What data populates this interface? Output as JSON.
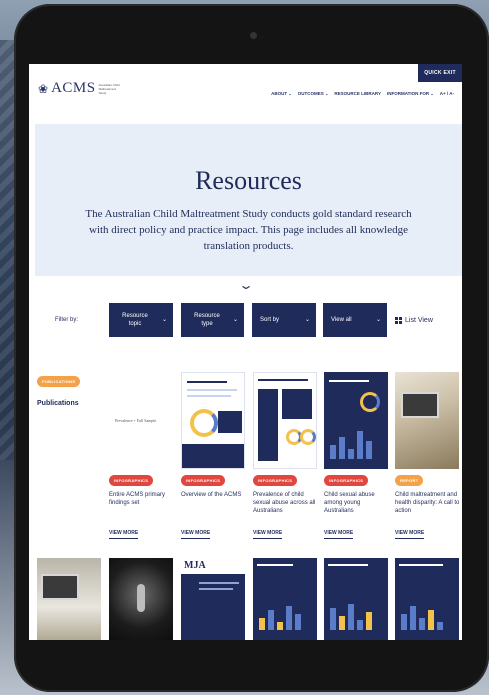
{
  "header": {
    "quick_exit": "QUICK EXIT",
    "logo_text": "ACMS",
    "logo_sub": "Australian Child Maltreatment Study",
    "menu": [
      "ABOUT",
      "OUTCOMES",
      "RESOURCE LIBRARY",
      "INFORMATION FOR",
      "A+ / A-"
    ]
  },
  "hero": {
    "title": "Resources",
    "text": "The Australian Child Maltreatment Study conducts gold standard research with direct policy and practice impact. This page includes all knowledge translation products."
  },
  "filters": {
    "label": "Filter by:",
    "buttons": [
      "Resource topic",
      "Resource type",
      "Sort by",
      "View all"
    ],
    "list_view": "List View"
  },
  "section": {
    "badge": "PUBLICATIONS",
    "label": "Publications"
  },
  "cards": [
    {
      "badge": "INFOGRAPHICS",
      "title": "Entire ACMS primary findings set",
      "thumb_text": "Prevalence + Full Sample",
      "view": "VIEW MORE"
    },
    {
      "badge": "INFOGRAPHICS",
      "title": "Overview of the ACMS",
      "view": "VIEW MORE"
    },
    {
      "badge": "INFOGRAPHICS",
      "title": "Prevalence of child sexual abuse across all Australians",
      "view": "VIEW MORE"
    },
    {
      "badge": "INFOGRAPHICS",
      "title": "Child sexual abuse among young Australians",
      "view": "VIEW MORE"
    },
    {
      "badge": "REPORT",
      "title": "Child maltreatment and health disparity: A call to action",
      "view": "VIEW MORE"
    }
  ],
  "row2": {
    "mja_label": "MJA"
  },
  "colors": {
    "navy": "#1f2b5a",
    "hero_bg": "#e8eef7",
    "badge_red": "#e2473f",
    "badge_orange": "#f3a24a"
  }
}
